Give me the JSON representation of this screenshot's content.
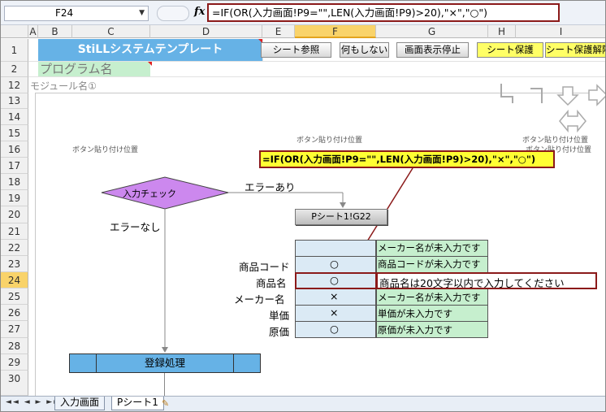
{
  "formula_bar": {
    "name_box": "F24",
    "fx": "fx",
    "formula": "=IF(OR(入力画面!P9=\"\",LEN(入力画面!P9)>20),\"×\",\"○\")"
  },
  "columns": [
    "A",
    "B",
    "C",
    "D",
    "E",
    "F",
    "G",
    "H",
    "I"
  ],
  "rows": [
    "1",
    "2",
    "12",
    "13",
    "14",
    "15",
    "16",
    "17",
    "18",
    "19",
    "20",
    "21",
    "22",
    "23",
    "24",
    "25",
    "26",
    "27",
    "28",
    "29",
    "30"
  ],
  "header_row": {
    "title": "StiLLシステムテンプレート",
    "buttons": [
      "シート参照",
      "何もしない",
      "画面表示停止",
      "シート保護",
      "シート保護解除"
    ],
    "program_name": "プログラム名"
  },
  "module_name": "モジュール名①",
  "button_positions": [
    "ボタン貼り付け位置",
    "ボタン貼り付け位置",
    "ボタン貼り付け位置",
    "ボタン貼り付け位置"
  ],
  "callout_formula": "=IF(OR(入力画面!P9=\"\",LEN(入力画面!P9)>20),\"×\",\"○\")",
  "flowchart": {
    "decision": "入力チェック",
    "branch_error": "エラーあり",
    "branch_ok": "エラーなし",
    "sheet_button": "Pシート1!G22",
    "process": "登録処理"
  },
  "table": {
    "header_message": "メーカー名が未入力です",
    "rows": [
      {
        "label": "商品コード",
        "mark": "○",
        "message": "商品コードが未入力です"
      },
      {
        "label": "商品名",
        "mark": "○",
        "message": "商品名は20文字以内で入力してください"
      },
      {
        "label": "メーカー名",
        "mark": "×",
        "message": "メーカー名が未入力です"
      },
      {
        "label": "単価",
        "mark": "×",
        "message": "単価が未入力です"
      },
      {
        "label": "原価",
        "mark": "○",
        "message": "原価が未入力です"
      }
    ]
  },
  "sheet_tabs": [
    "入力画面",
    "Pシート1"
  ],
  "colors": {
    "accent": "#8b1a1a",
    "title_bg": "#66b2e6",
    "program_bg": "#c6efce",
    "table_blue": "#dbeaf5",
    "table_green": "#c6efce",
    "decision": "#cc88ee",
    "selection": "#f9d36a"
  }
}
